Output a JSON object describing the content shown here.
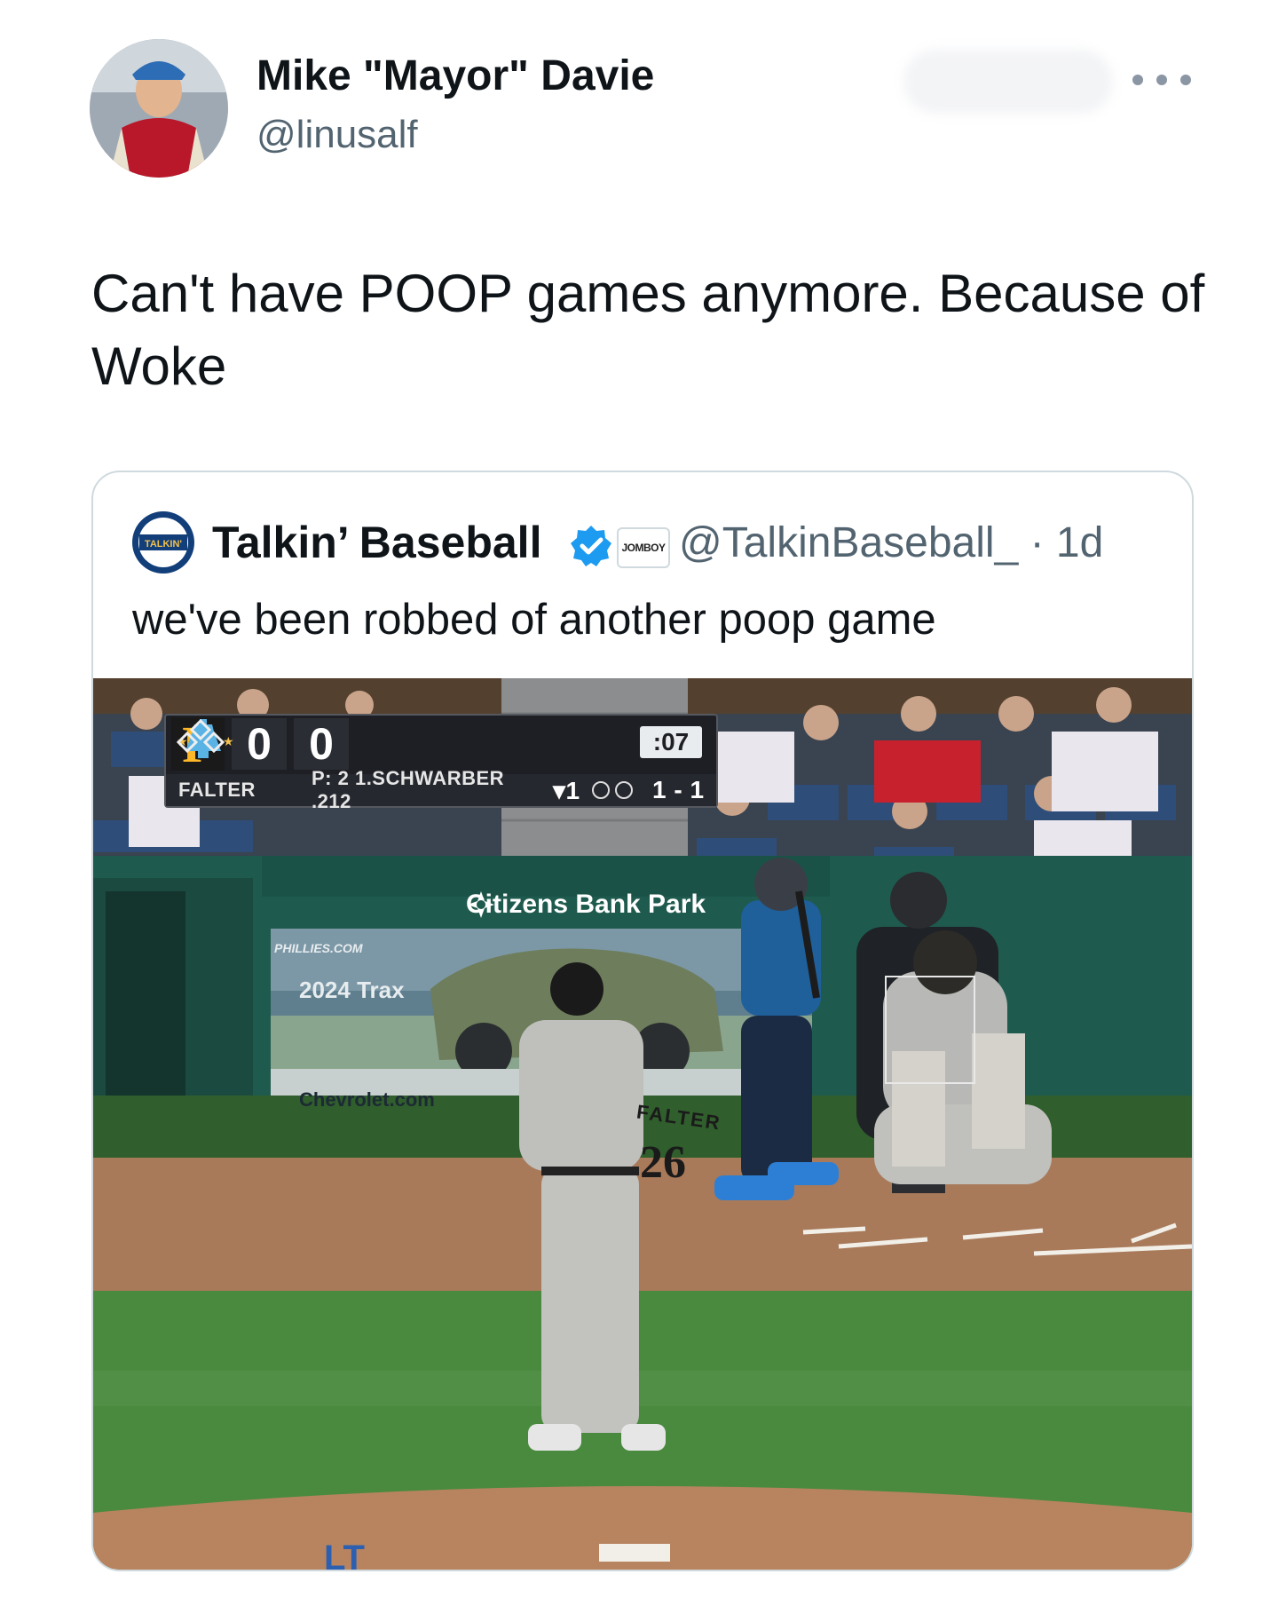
{
  "tweet": {
    "author_name": "Mike \"Mayor\" Davie",
    "author_handle": "@linusalf",
    "text": "Can't have POOP games anymore. Because of Woke"
  },
  "quoted_tweet": {
    "author_name": "Talkin’ Baseball",
    "affiliate_badge": "JOMBOY",
    "handle_time": "@TalkinBaseball_ · 1d",
    "text": "we've been robbed of another poop game",
    "logo_text": "TALKIN' Baseball"
  },
  "scorebug": {
    "away_logo": "P",
    "away_score": "0",
    "home_score": "0",
    "clock": ":07",
    "pitcher": "FALTER",
    "batter_info": "P: 2  1.SCHWARBER .212",
    "inning": "▾1",
    "count": "1 - 1"
  },
  "video_text": {
    "park": "Citizens Bank Park",
    "ad_title": "2024 Trax",
    "ad_site": "Chevrolet.com",
    "ad_brand": "PHILLIES.COM",
    "jersey_name": "FALTER",
    "jersey_number": "26"
  },
  "icons": [
    "more-options-icon",
    "verified-badge-icon",
    "citizens-bank-logo-icon",
    "phillies-bell-icon",
    "bases-diamond-icon"
  ],
  "colors": {
    "verified": "#1d9bf0",
    "secondary_text": "#536471",
    "pirates_gold": "#fdb827",
    "field_green": "#3f7a3a"
  }
}
